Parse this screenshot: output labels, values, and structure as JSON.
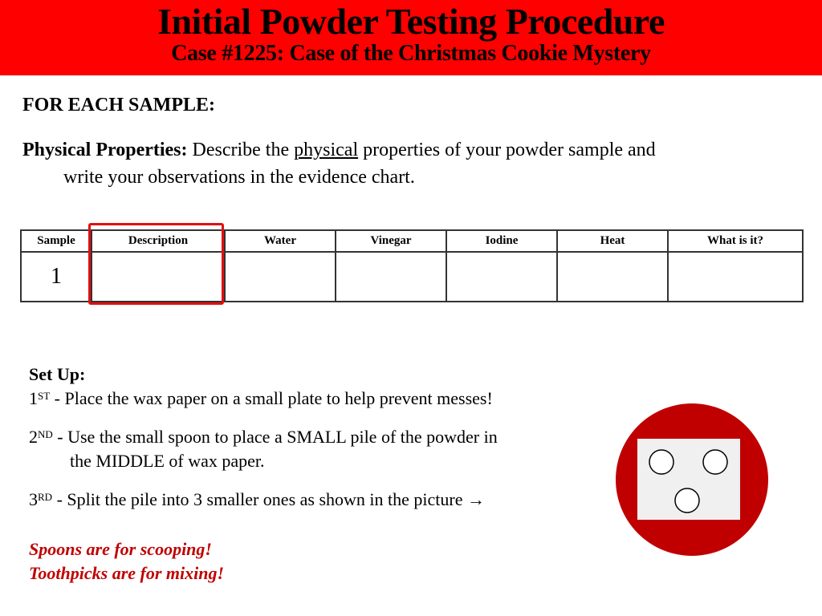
{
  "header": {
    "title": "Initial Powder Testing Procedure",
    "subtitle": "Case #1225:  Case of the Christmas Cookie Mystery",
    "background_color": "#ff0000"
  },
  "instructions": {
    "for_each": "FOR EACH SAMPLE:",
    "physical_label": "Physical Properties:",
    "physical_text_before": " Describe the ",
    "physical_underlined": "physical",
    "physical_text_after": " properties of your powder sample and",
    "physical_text_line2": "write your observations in the evidence chart."
  },
  "evidence_table": {
    "columns": [
      "Sample",
      "Description",
      "Water",
      "Vinegar",
      "Iodine",
      "Heat",
      "What is it?"
    ],
    "rows": [
      [
        "1",
        "",
        "",
        "",
        "",
        "",
        ""
      ]
    ],
    "highlighted_column": "Description",
    "highlight_color": "#e01010"
  },
  "setup": {
    "heading": "Set Up:",
    "steps": [
      {
        "num": "1",
        "suffix": "ST",
        "text": " - Place the wax paper on a small plate to help prevent messes!",
        "cont": ""
      },
      {
        "num": "2",
        "suffix": "ND",
        "text": " - Use the small spoon to place a SMALL pile of the powder in",
        "cont": "the MIDDLE of wax paper."
      },
      {
        "num": "3",
        "suffix": "RD",
        "text": " - Split the pile into 3 smaller ones as shown in the picture ",
        "cont": ""
      }
    ],
    "arrow": "→"
  },
  "warnings": {
    "line1": "Spoons are for scooping!",
    "line2": "Toothpicks are for mixing!",
    "color": "#c00000"
  },
  "diagram": {
    "plate_color": "#c00000",
    "wax_paper_color": "#f0f0f0",
    "pile_count": 3
  }
}
